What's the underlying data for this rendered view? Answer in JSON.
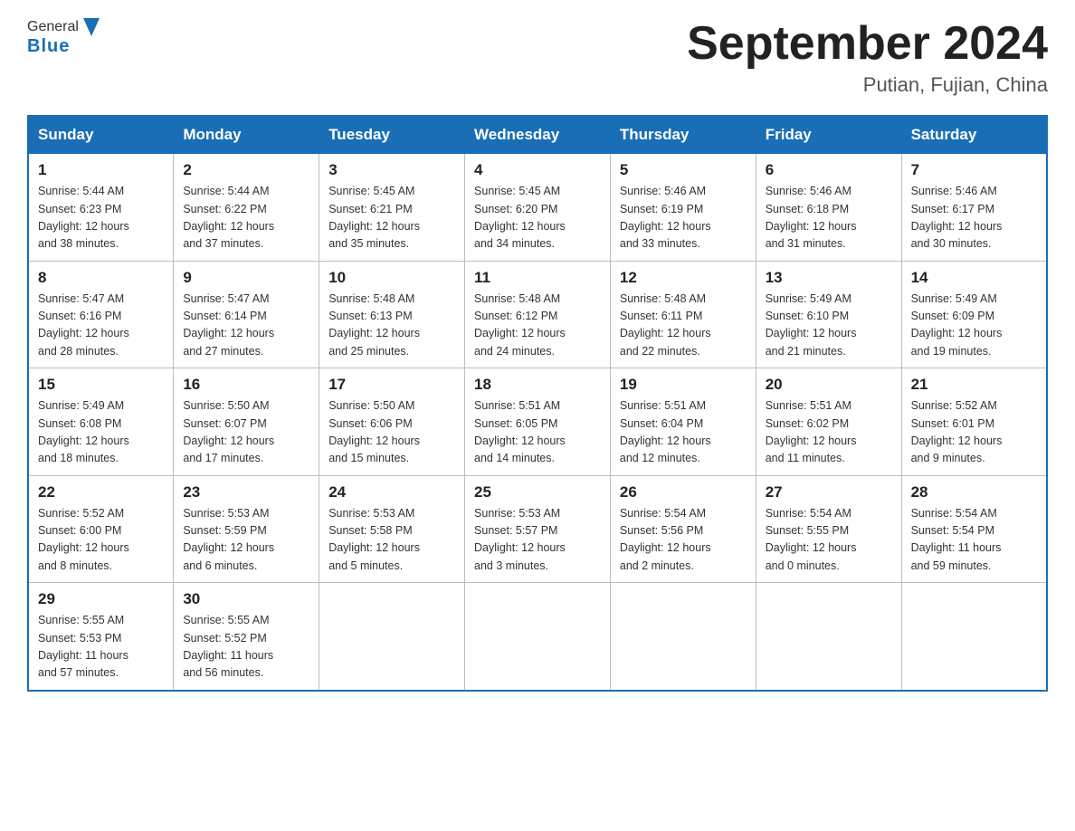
{
  "header": {
    "logo_general": "General",
    "logo_blue": "Blue",
    "title": "September 2024",
    "location": "Putian, Fujian, China"
  },
  "weekdays": [
    "Sunday",
    "Monday",
    "Tuesday",
    "Wednesday",
    "Thursday",
    "Friday",
    "Saturday"
  ],
  "weeks": [
    [
      {
        "day": "1",
        "sunrise": "5:44 AM",
        "sunset": "6:23 PM",
        "daylight": "12 hours and 38 minutes."
      },
      {
        "day": "2",
        "sunrise": "5:44 AM",
        "sunset": "6:22 PM",
        "daylight": "12 hours and 37 minutes."
      },
      {
        "day": "3",
        "sunrise": "5:45 AM",
        "sunset": "6:21 PM",
        "daylight": "12 hours and 35 minutes."
      },
      {
        "day": "4",
        "sunrise": "5:45 AM",
        "sunset": "6:20 PM",
        "daylight": "12 hours and 34 minutes."
      },
      {
        "day": "5",
        "sunrise": "5:46 AM",
        "sunset": "6:19 PM",
        "daylight": "12 hours and 33 minutes."
      },
      {
        "day": "6",
        "sunrise": "5:46 AM",
        "sunset": "6:18 PM",
        "daylight": "12 hours and 31 minutes."
      },
      {
        "day": "7",
        "sunrise": "5:46 AM",
        "sunset": "6:17 PM",
        "daylight": "12 hours and 30 minutes."
      }
    ],
    [
      {
        "day": "8",
        "sunrise": "5:47 AM",
        "sunset": "6:16 PM",
        "daylight": "12 hours and 28 minutes."
      },
      {
        "day": "9",
        "sunrise": "5:47 AM",
        "sunset": "6:14 PM",
        "daylight": "12 hours and 27 minutes."
      },
      {
        "day": "10",
        "sunrise": "5:48 AM",
        "sunset": "6:13 PM",
        "daylight": "12 hours and 25 minutes."
      },
      {
        "day": "11",
        "sunrise": "5:48 AM",
        "sunset": "6:12 PM",
        "daylight": "12 hours and 24 minutes."
      },
      {
        "day": "12",
        "sunrise": "5:48 AM",
        "sunset": "6:11 PM",
        "daylight": "12 hours and 22 minutes."
      },
      {
        "day": "13",
        "sunrise": "5:49 AM",
        "sunset": "6:10 PM",
        "daylight": "12 hours and 21 minutes."
      },
      {
        "day": "14",
        "sunrise": "5:49 AM",
        "sunset": "6:09 PM",
        "daylight": "12 hours and 19 minutes."
      }
    ],
    [
      {
        "day": "15",
        "sunrise": "5:49 AM",
        "sunset": "6:08 PM",
        "daylight": "12 hours and 18 minutes."
      },
      {
        "day": "16",
        "sunrise": "5:50 AM",
        "sunset": "6:07 PM",
        "daylight": "12 hours and 17 minutes."
      },
      {
        "day": "17",
        "sunrise": "5:50 AM",
        "sunset": "6:06 PM",
        "daylight": "12 hours and 15 minutes."
      },
      {
        "day": "18",
        "sunrise": "5:51 AM",
        "sunset": "6:05 PM",
        "daylight": "12 hours and 14 minutes."
      },
      {
        "day": "19",
        "sunrise": "5:51 AM",
        "sunset": "6:04 PM",
        "daylight": "12 hours and 12 minutes."
      },
      {
        "day": "20",
        "sunrise": "5:51 AM",
        "sunset": "6:02 PM",
        "daylight": "12 hours and 11 minutes."
      },
      {
        "day": "21",
        "sunrise": "5:52 AM",
        "sunset": "6:01 PM",
        "daylight": "12 hours and 9 minutes."
      }
    ],
    [
      {
        "day": "22",
        "sunrise": "5:52 AM",
        "sunset": "6:00 PM",
        "daylight": "12 hours and 8 minutes."
      },
      {
        "day": "23",
        "sunrise": "5:53 AM",
        "sunset": "5:59 PM",
        "daylight": "12 hours and 6 minutes."
      },
      {
        "day": "24",
        "sunrise": "5:53 AM",
        "sunset": "5:58 PM",
        "daylight": "12 hours and 5 minutes."
      },
      {
        "day": "25",
        "sunrise": "5:53 AM",
        "sunset": "5:57 PM",
        "daylight": "12 hours and 3 minutes."
      },
      {
        "day": "26",
        "sunrise": "5:54 AM",
        "sunset": "5:56 PM",
        "daylight": "12 hours and 2 minutes."
      },
      {
        "day": "27",
        "sunrise": "5:54 AM",
        "sunset": "5:55 PM",
        "daylight": "12 hours and 0 minutes."
      },
      {
        "day": "28",
        "sunrise": "5:54 AM",
        "sunset": "5:54 PM",
        "daylight": "11 hours and 59 minutes."
      }
    ],
    [
      {
        "day": "29",
        "sunrise": "5:55 AM",
        "sunset": "5:53 PM",
        "daylight": "11 hours and 57 minutes."
      },
      {
        "day": "30",
        "sunrise": "5:55 AM",
        "sunset": "5:52 PM",
        "daylight": "11 hours and 56 minutes."
      },
      null,
      null,
      null,
      null,
      null
    ]
  ],
  "labels": {
    "sunrise": "Sunrise:",
    "sunset": "Sunset:",
    "daylight": "Daylight:"
  }
}
